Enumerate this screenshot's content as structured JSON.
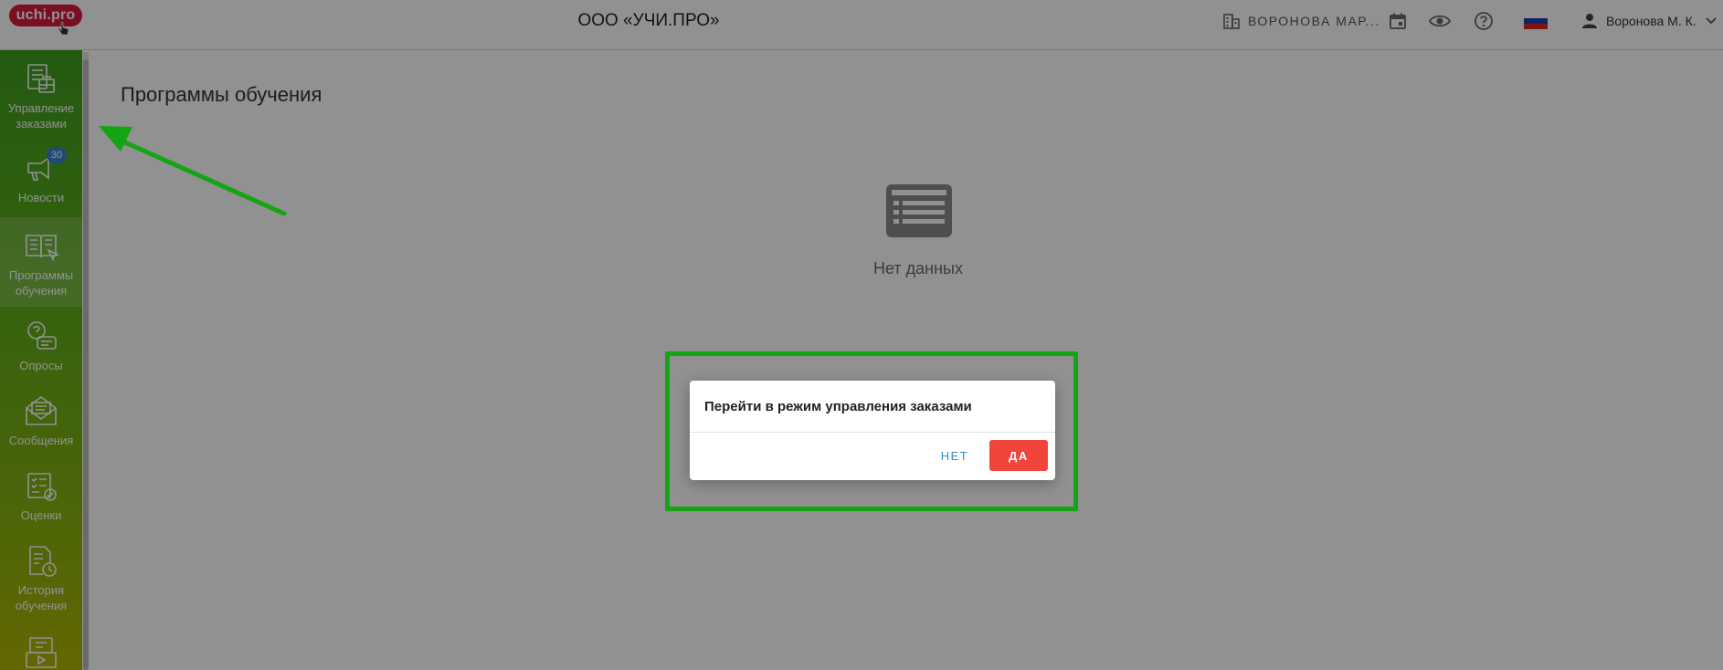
{
  "header": {
    "logo_text": "uchi.pro",
    "org_title": "ООО «УЧИ.ПРО»",
    "branch_label": "ВОРОНОВА МАР...",
    "user_name": "Воронова М. К.",
    "icons": [
      "building-icon",
      "calendar-icon",
      "eye-icon",
      "help-icon",
      "flag-ru-icon",
      "user-icon",
      "chevron-down-icon"
    ]
  },
  "sidebar": {
    "items": [
      {
        "label_line1": "Управление",
        "label_line2": "заказами",
        "icon": "orders-icon"
      },
      {
        "label_line1": "Новости",
        "label_line2": "",
        "icon": "news-icon",
        "badge": "30"
      },
      {
        "label_line1": "Программы",
        "label_line2": "обучения",
        "icon": "programs-icon",
        "active": true
      },
      {
        "label_line1": "Опросы",
        "label_line2": "",
        "icon": "surveys-icon"
      },
      {
        "label_line1": "Сообщения",
        "label_line2": "",
        "icon": "messages-icon"
      },
      {
        "label_line1": "Оценки",
        "label_line2": "",
        "icon": "grades-icon"
      },
      {
        "label_line1": "История",
        "label_line2": "обучения",
        "icon": "history-icon"
      },
      {
        "label_line1": "",
        "label_line2": "",
        "icon": "video-icon"
      }
    ]
  },
  "main": {
    "page_title": "Программы обучения",
    "empty_text": "Нет данных"
  },
  "dialog": {
    "title": "Перейти в режим управления заказами",
    "no_label": "НЕТ",
    "yes_label": "ДА"
  },
  "colors": {
    "brand_red": "#d8193f",
    "sidebar_green": "#3f9f1f",
    "sidebar_olive": "#b1b406",
    "confirm_red": "#f1453b",
    "link_blue": "#2f8fcf",
    "annotation_green": "#14a414",
    "badge_blue": "#3b82d6"
  }
}
